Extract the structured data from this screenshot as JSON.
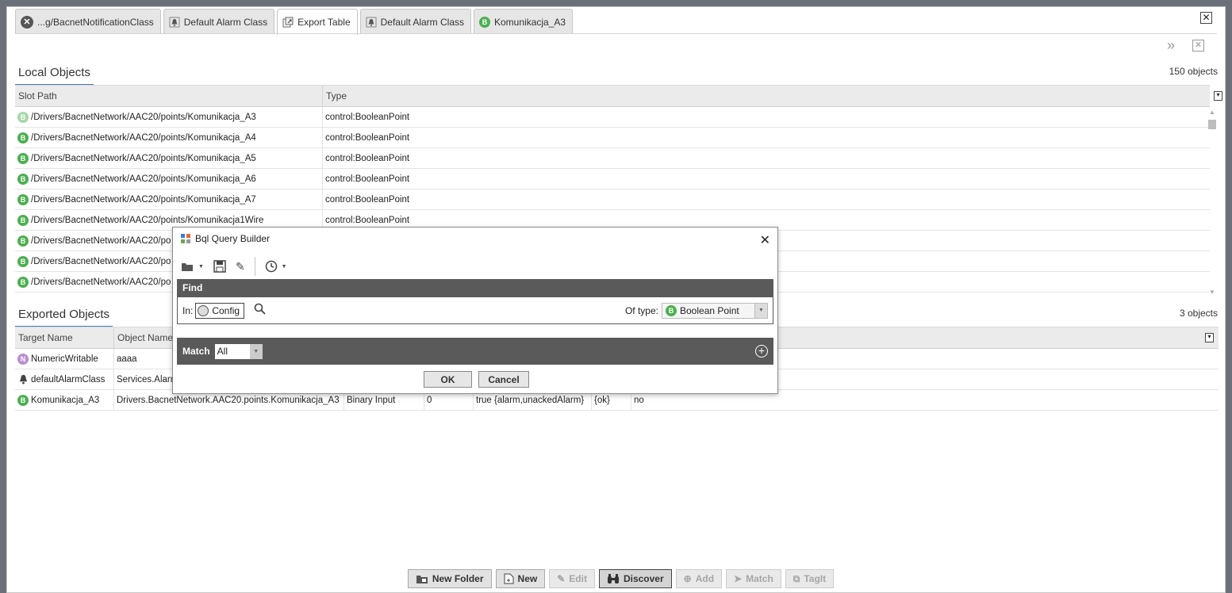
{
  "tabs": [
    {
      "label": "...g/BacnetNotificationClass",
      "icon": "close-circle-icon",
      "active": false
    },
    {
      "label": "Default Alarm Class",
      "icon": "alarm-class-icon",
      "active": false
    },
    {
      "label": "Export Table",
      "icon": "export-table-icon",
      "active": true
    },
    {
      "label": "Default Alarm Class",
      "icon": "alarm-class-icon",
      "active": false
    },
    {
      "label": "Komunikacja_A3",
      "icon": "boolean-point-icon",
      "active": false
    }
  ],
  "local": {
    "title": "Local Objects",
    "count": "150 objects",
    "columns": [
      "Slot Path",
      "Type"
    ],
    "rows": [
      {
        "path": "/Drivers/BacnetNetwork/AAC20/points/Komunikacja_A3",
        "type": "control:BooleanPoint"
      },
      {
        "path": "/Drivers/BacnetNetwork/AAC20/points/Komunikacja_A4",
        "type": "control:BooleanPoint"
      },
      {
        "path": "/Drivers/BacnetNetwork/AAC20/points/Komunikacja_A5",
        "type": "control:BooleanPoint"
      },
      {
        "path": "/Drivers/BacnetNetwork/AAC20/points/Komunikacja_A6",
        "type": "control:BooleanPoint"
      },
      {
        "path": "/Drivers/BacnetNetwork/AAC20/points/Komunikacja_A7",
        "type": "control:BooleanPoint"
      },
      {
        "path": "/Drivers/BacnetNetwork/AAC20/points/Komunikacja1Wire",
        "type": "control:BooleanPoint"
      },
      {
        "path": "/Drivers/BacnetNetwork/AAC20/po",
        "type": ""
      },
      {
        "path": "/Drivers/BacnetNetwork/AAC20/po",
        "type": ""
      },
      {
        "path": "/Drivers/BacnetNetwork/AAC20/po",
        "type": ""
      }
    ]
  },
  "exported": {
    "title": "Exported Objects",
    "count": "3 objects",
    "columns": [
      "Target Name",
      "Object Name"
    ],
    "rows": [
      {
        "target": "NumericWritable",
        "object": "aaaa",
        "c3": "",
        "c4": "",
        "c5": "",
        "c6": "",
        "c7": ""
      },
      {
        "target": "defaultAlarmClass",
        "object": "Services.Alarm",
        "c3": "",
        "c4": "",
        "c5": "",
        "c6": "",
        "c7": ""
      },
      {
        "target": "Komunikacja_A3",
        "object": "Drivers.BacnetNetwork.AAC20.points.Komunikacja_A3",
        "c3": "Binary Input",
        "c4": "0",
        "c5": "true {alarm,unackedAlarm}",
        "c6": "{ok}",
        "c7": "no"
      }
    ]
  },
  "bottom_buttons": {
    "new_folder": "New Folder",
    "new": "New",
    "edit": "Edit",
    "discover": "Discover",
    "add": "Add",
    "match": "Match",
    "tagit": "TagIt"
  },
  "dialog": {
    "title": "Bql Query Builder",
    "find_label": "Find",
    "in_label": "In:",
    "in_value": "Config",
    "of_type_label": "Of type:",
    "of_type_value": "Boolean Point",
    "match_label": "Match",
    "match_value": "All",
    "ok": "OK",
    "cancel": "Cancel"
  }
}
